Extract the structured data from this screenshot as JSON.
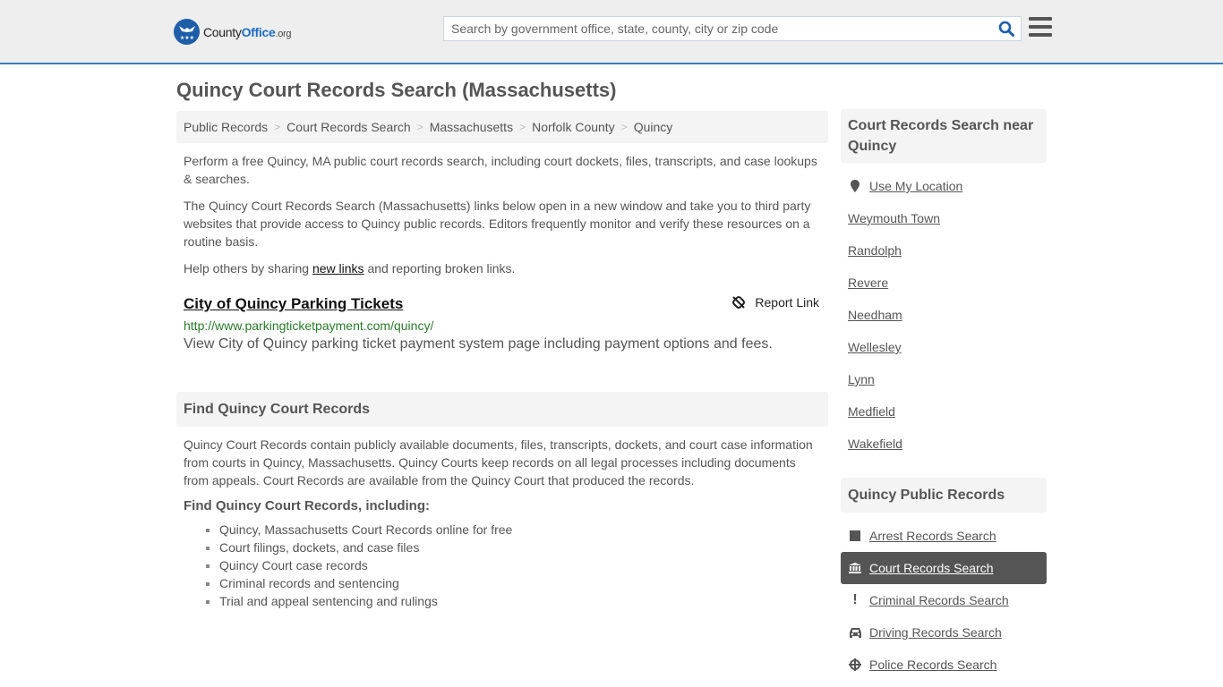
{
  "header": {
    "logo": {
      "part1": "County",
      "part2": "Office",
      "part3": ".org"
    },
    "search_placeholder": "Search by government office, state, county, city or zip code",
    "search_value": ""
  },
  "page_title": "Quincy Court Records Search (Massachusetts)",
  "breadcrumb": [
    "Public Records",
    "Court Records Search",
    "Massachusetts",
    "Norfolk County",
    "Quincy"
  ],
  "intro": {
    "p1": "Perform a free Quincy, MA public court records search, including court dockets, files, transcripts, and case lookups & searches.",
    "p2": "The Quincy Court Records Search (Massachusetts) links below open in a new window and take you to third party websites that provide access to Quincy public records. Editors frequently monitor and verify these resources on a routine basis.",
    "p3_before": "Help others by sharing ",
    "p3_link": "new links",
    "p3_after": " and reporting broken links."
  },
  "listing": {
    "title": "City of Quincy Parking Tickets",
    "report_label": "Report Link",
    "url": "http://www.parkingticketpayment.com/quincy/",
    "description": "View City of Quincy parking ticket payment system page including payment options and fees."
  },
  "find_section": {
    "heading": "Find Quincy Court Records",
    "paragraph": "Quincy Court Records contain publicly available documents, files, transcripts, dockets, and court case information from courts in Quincy, Massachusetts. Quincy Courts keep records on all legal processes including documents from appeals. Court Records are available from the Quincy Court that produced the records.",
    "subheading": "Find Quincy Court Records, including:",
    "bullets": [
      "Quincy, Massachusetts Court Records online for free",
      "Court filings, dockets, and case files",
      "Quincy Court case records",
      "Criminal records and sentencing",
      "Trial and appeal sentencing and rulings"
    ]
  },
  "sidebar": {
    "nearby_heading": "Court Records Search near Quincy",
    "use_location": "Use My Location",
    "nearby": [
      "Weymouth Town",
      "Randolph",
      "Revere",
      "Needham",
      "Wellesley",
      "Lynn",
      "Medfield",
      "Wakefield"
    ],
    "public_heading": "Quincy Public Records",
    "public_records": [
      {
        "label": "Arrest Records Search",
        "icon": "square-icon",
        "active": false
      },
      {
        "label": "Court Records Search",
        "icon": "courthouse-icon",
        "active": true
      },
      {
        "label": "Criminal Records Search",
        "icon": "exclamation-icon",
        "active": false
      },
      {
        "label": "Driving Records Search",
        "icon": "car-icon",
        "active": false
      },
      {
        "label": "Police Records Search",
        "icon": "crosshair-icon",
        "active": false
      }
    ]
  },
  "colors": {
    "accent": "#3c7dbc",
    "brand": "#1e5ea8",
    "url_green": "#2a7a2a",
    "active_bg": "#555555"
  }
}
